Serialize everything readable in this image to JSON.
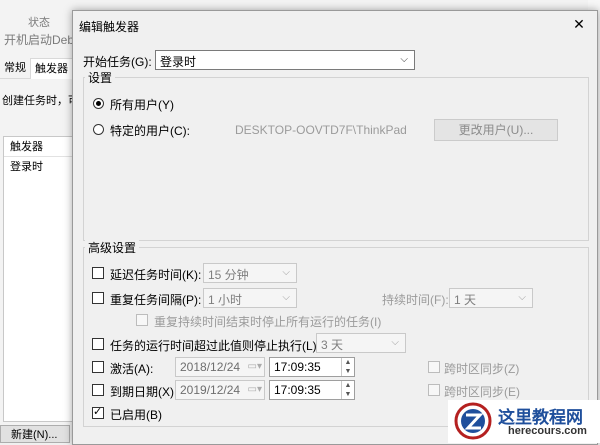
{
  "background": {
    "state_label": "状态",
    "title": "开机启动Debe",
    "tabs": [
      "常规",
      "触发器"
    ],
    "description": "创建任务时，可",
    "list_header": "触发器",
    "list_row": "登录时",
    "new_button": "新建(N)..."
  },
  "dialog": {
    "title": "编辑触发器",
    "close_glyph": "✕",
    "start_task_label": "开始任务(G):",
    "start_task_value": "登录时",
    "settings": {
      "legend": "设置",
      "all_users_label": "所有用户(Y)",
      "specific_user_label": "特定的用户(C):",
      "user_name": "DESKTOP-OOVTD7F\\ThinkPad",
      "change_user_button": "更改用户(U)..."
    },
    "advanced": {
      "legend": "高级设置",
      "delay_label": "延迟任务时间(K):",
      "delay_value": "15 分钟",
      "repeat_label": "重复任务间隔(P):",
      "repeat_value": "1 小时",
      "duration_label": "持续时间(F):",
      "duration_value": "1 天",
      "stop_running_label": "重复持续时间结束时停止所有运行的任务(I)",
      "stop_if_longer_label": "任务的运行时间超过此值则停止执行(L):",
      "stop_if_longer_value": "3 天",
      "activate_label": "激活(A):",
      "activate_date": "2018/12/24",
      "activate_time": "17:09:35",
      "activate_sync_label": "跨时区同步(Z)",
      "expire_label": "到期日期(X):",
      "expire_date": "2019/12/24",
      "expire_time": "17:09:35",
      "expire_sync_label": "跨时区同步(E)",
      "enabled_label": "已启用(B)"
    }
  },
  "watermark": {
    "text": "这里教程网",
    "url": "herecours.com"
  },
  "colors": {
    "dialog_bg": "#f0f0f0",
    "disabled_text": "#9b9b9b",
    "watermark_blue": "#1f4f9c"
  }
}
